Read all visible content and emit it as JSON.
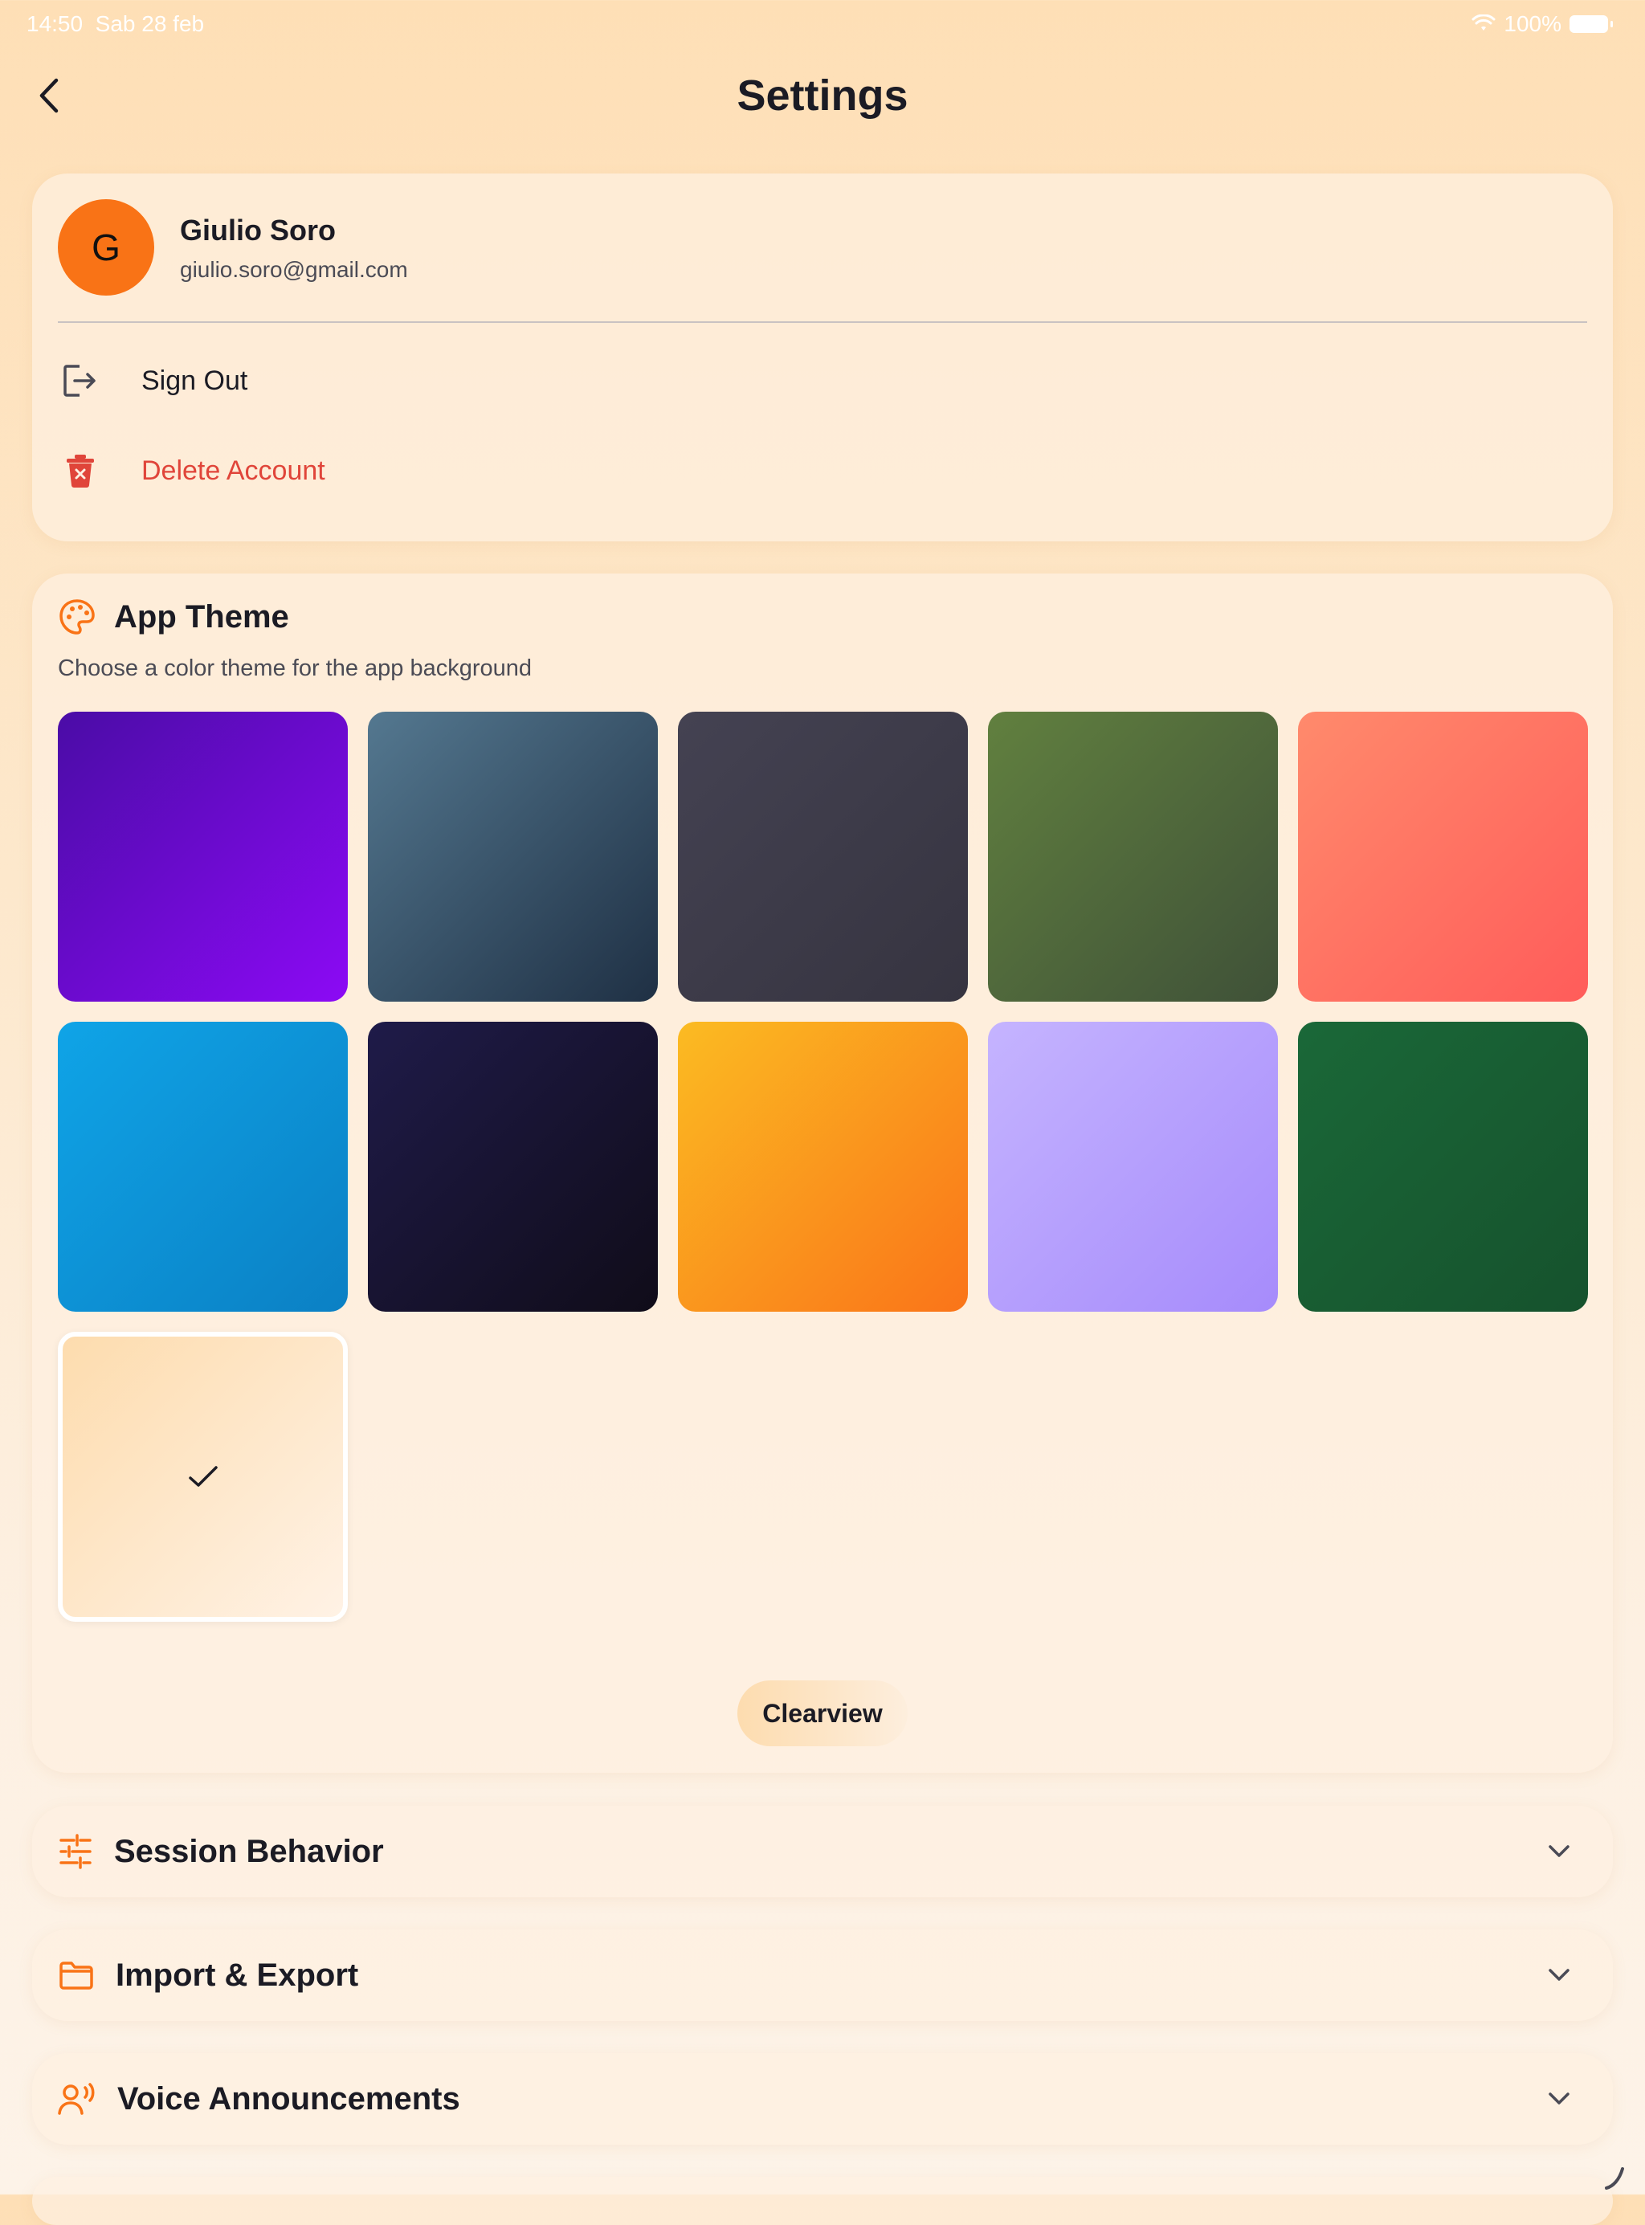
{
  "status_bar": {
    "time": "14:50",
    "date": "Sab 28 feb",
    "battery": "100%"
  },
  "header": {
    "title": "Settings"
  },
  "account": {
    "avatar_initial": "G",
    "name": "Giulio Soro",
    "email": "giulio.soro@gmail.com",
    "sign_out_label": "Sign Out",
    "delete_label": "Delete Account"
  },
  "theme": {
    "title": "App Theme",
    "description": "Choose a color theme for the app background",
    "selected_name": "Clearview",
    "swatches": [
      {
        "from": "#4a0ca6",
        "to": "#8c0af5",
        "selected": false
      },
      {
        "from": "#547890",
        "to": "#1f3044",
        "selected": false
      },
      {
        "from": "#444252",
        "to": "#363440",
        "selected": false
      },
      {
        "from": "#61803f",
        "to": "#3f5138",
        "selected": false
      },
      {
        "from": "#ff8a6c",
        "to": "#ff5c5a",
        "selected": false
      },
      {
        "from": "#0fa4e7",
        "to": "#0b80c4",
        "selected": false
      },
      {
        "from": "#1f1b49",
        "to": "#100c19",
        "selected": false
      },
      {
        "from": "#fbbb22",
        "to": "#fa7419",
        "selected": false
      },
      {
        "from": "#c5b4ff",
        "to": "#a68bfb",
        "selected": false
      },
      {
        "from": "#1a6838",
        "to": "#16522d",
        "selected": false
      },
      {
        "from": "#fddcae",
        "to": "#fff2e5",
        "selected": true
      }
    ]
  },
  "sections": [
    {
      "title": "Session Behavior",
      "icon": "sliders-icon"
    },
    {
      "title": "Import & Export",
      "icon": "folder-icon"
    },
    {
      "title": "Voice Announcements",
      "icon": "voice-icon"
    }
  ],
  "colors": {
    "accent": "#f97316",
    "danger": "#e0453a",
    "text": "#1b1b24"
  }
}
